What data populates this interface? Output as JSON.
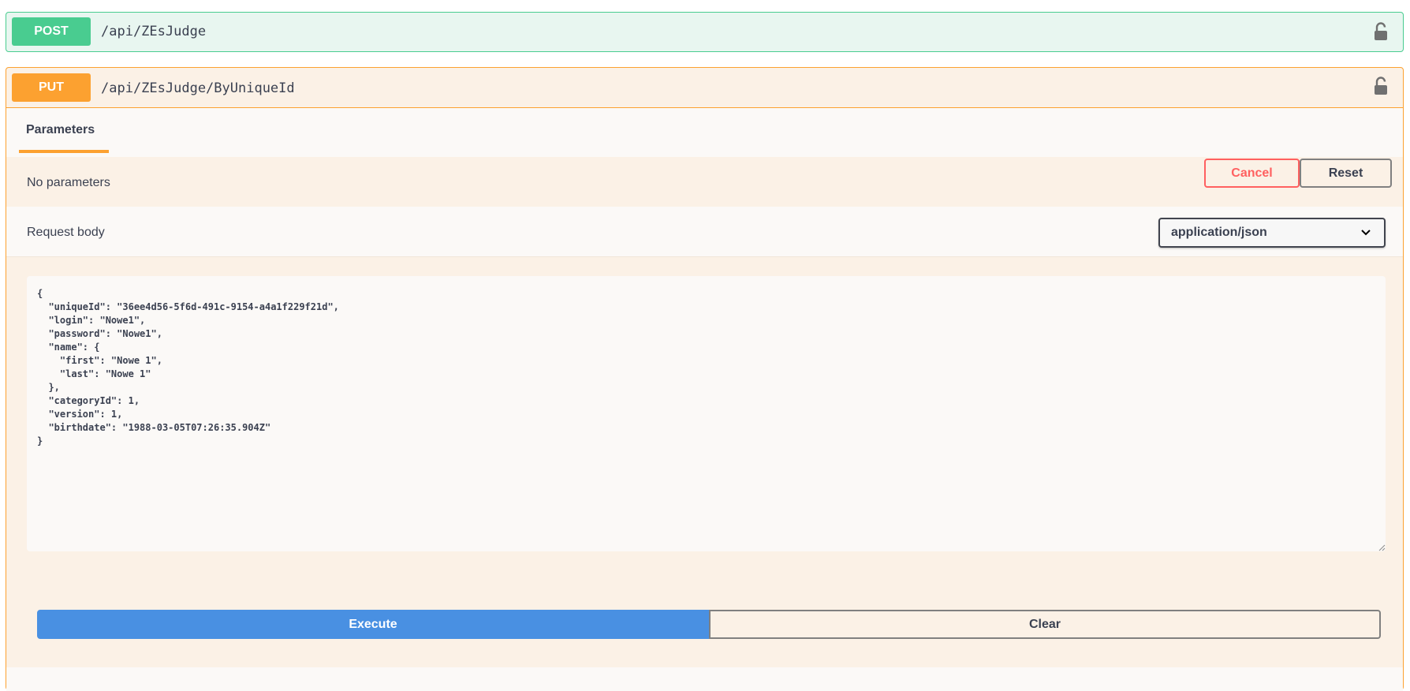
{
  "post_op": {
    "method": "POST",
    "path": "/api/ZEsJudge",
    "lock_icon": "lock-open-icon",
    "color": "#49cc90"
  },
  "put_op": {
    "method": "PUT",
    "path": "/api/ZEsJudge/ByUniqueId",
    "lock_icon": "lock-open-icon",
    "color": "#fca130",
    "tab_label": "Parameters",
    "cancel_label": "Cancel",
    "reset_label": "Reset",
    "no_params_text": "No parameters",
    "request_body_label": "Request body",
    "content_type": "application/json",
    "body_text": "{\n  \"uniqueId\": \"36ee4d56-5f6d-491c-9154-a4a1f229f21d\",\n  \"login\": \"Nowe1\",\n  \"password\": \"Nowe1\",\n  \"name\": {\n    \"first\": \"Nowe 1\",\n    \"last\": \"Nowe 1\"\n  },\n  \"categoryId\": 1,\n  \"version\": 1,\n  \"birthdate\": \"1988-03-05T07:26:35.904Z\"\n}",
    "execute_label": "Execute",
    "clear_label": "Clear"
  },
  "colors": {
    "execute": "#4990e2",
    "cancel": "#ff6060"
  }
}
